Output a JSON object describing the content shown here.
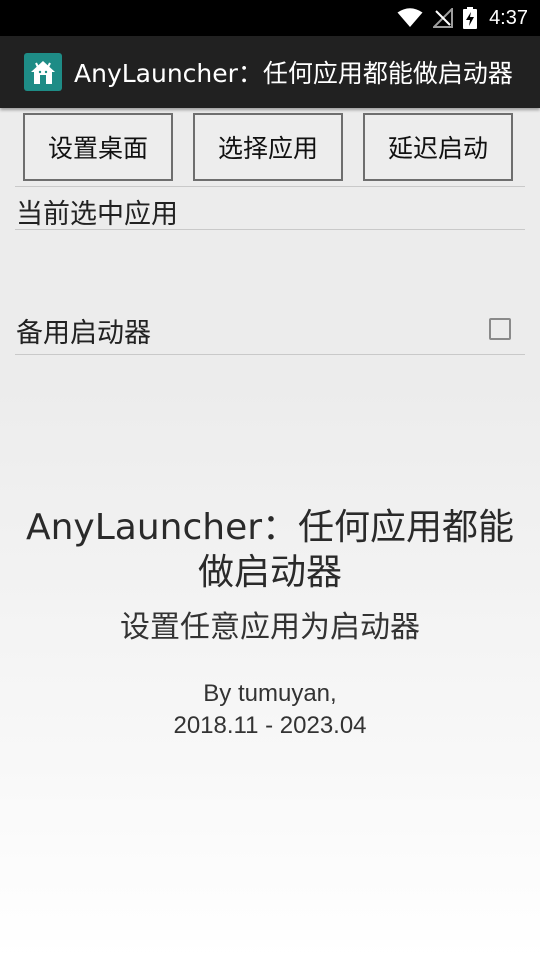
{
  "status_bar": {
    "time": "4:37",
    "icons": [
      "wifi-icon",
      "no-signal-icon",
      "battery-charging-icon"
    ]
  },
  "app_bar": {
    "title": "AnyLauncher：任何应用都能做启动器",
    "icon": "home-icon",
    "icon_color": "#1e8c86"
  },
  "buttons": {
    "set_desktop": "设置桌面",
    "choose_app": "选择应用",
    "delay_launch": "延迟启动"
  },
  "current_app": {
    "label": "当前选中应用",
    "value": ""
  },
  "backup_launcher": {
    "label": "备用启动器",
    "checked": false
  },
  "about": {
    "title_line1": "AnyLauncher：任何应用都能",
    "title_line2": "做启动器",
    "subtitle": "设置任意应用为启动器",
    "author": "By tumuyan,",
    "date_range": "2018.11 - 2023.04"
  }
}
